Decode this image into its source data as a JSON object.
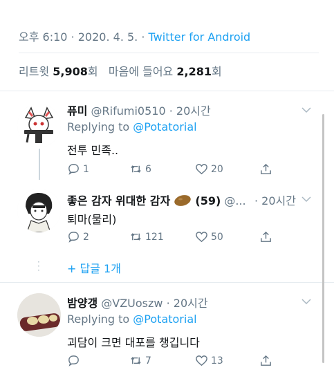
{
  "meta": {
    "time": "오후 6:10",
    "sep1": "·",
    "date": "2020. 4. 5.",
    "sep2": "·",
    "client": "Twitter for Android"
  },
  "stats": {
    "retweet_label": "리트윗",
    "retweet_count": "5,908",
    "retweet_unit": "회",
    "like_label": "마음에 들어요",
    "like_count": "2,281",
    "like_unit": "회"
  },
  "replies": [
    {
      "name": "퓨미",
      "handle": "@Rifumi0510",
      "time": "· 20시간",
      "replying_label": "Replying to",
      "replying_to": "@Potatorial",
      "text": "전투 민족..",
      "reply_count": "1",
      "retweet_count": "6",
      "like_count": "20"
    },
    {
      "name": "좋은 감자 위대한 감자",
      "emoji_label": "(59)",
      "handle": "@...",
      "time": "· 20시간",
      "text": "퇴마(물리)",
      "reply_count": "2",
      "retweet_count": "121",
      "like_count": "50"
    },
    {
      "name": "밤양갱",
      "handle": "@VZUoszw",
      "time": "· 20시간",
      "replying_label": "Replying to",
      "replying_to": "@Potatorial",
      "text": "괴담이 크면 대포를 챙깁니다",
      "reply_count": "",
      "retweet_count": "7",
      "like_count": "13"
    }
  ],
  "more_replies": "+ 답글 1개",
  "colors": {
    "accent": "#1da1f2",
    "muted": "#657786",
    "text": "#14171a"
  }
}
